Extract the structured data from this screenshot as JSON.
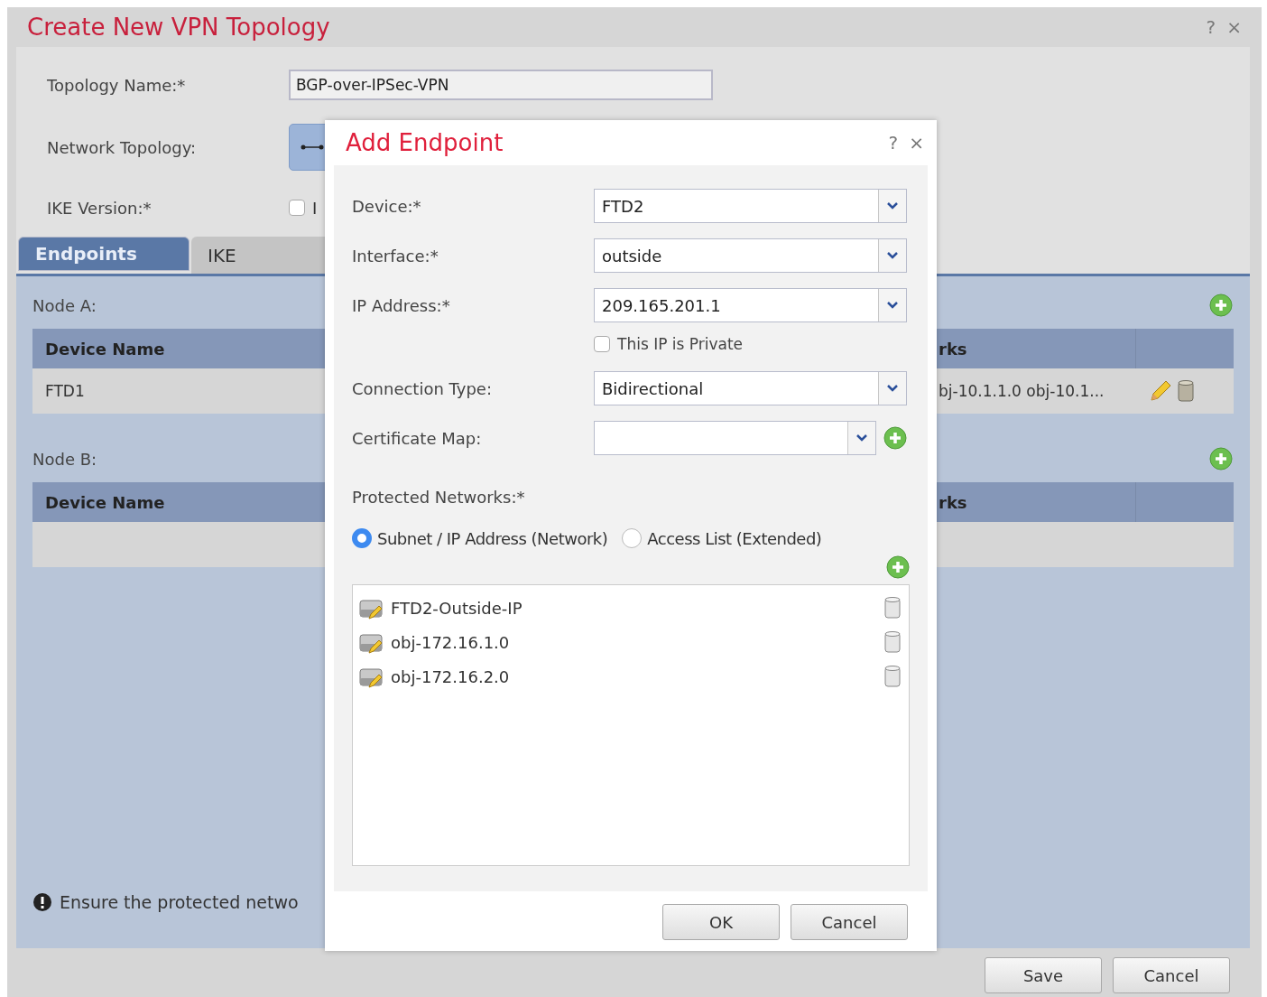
{
  "window": {
    "title": "Create New VPN Topology",
    "help": "?",
    "close": "×"
  },
  "form": {
    "topology_name": {
      "label": "Topology Name:*",
      "value": "BGP-over-IPSec-VPN"
    },
    "network_topology": {
      "label": "Network Topology:"
    },
    "ike_version": {
      "label": "IKE Version:*",
      "checked": false,
      "option": "I"
    }
  },
  "tabs": [
    {
      "label": "Endpoints",
      "selected": true
    },
    {
      "label": "IKE",
      "selected": false
    }
  ],
  "nodes": [
    {
      "label": "Node A:",
      "columns": [
        "Device Name",
        "rks"
      ],
      "rows": [
        {
          "device": "FTD1",
          "networks": "bj-10.1.1.0 obj-10.1..."
        }
      ]
    },
    {
      "label": "Node B:",
      "columns": [
        "Device Name",
        "rks"
      ]
    }
  ],
  "note": "Ensure the protected netwo",
  "footer_buttons": [
    "Save",
    "Cancel"
  ],
  "dialog": {
    "title": "Add Endpoint",
    "help": "?",
    "close": "×",
    "fields": [
      {
        "kind": "select",
        "label": "Device:*",
        "value": "FTD2"
      },
      {
        "kind": "select",
        "label": "Interface:*",
        "value": "outside"
      },
      {
        "kind": "select",
        "label": "IP Address:*",
        "value": "209.165.201.1"
      },
      {
        "kind": "checkbox",
        "label": "This IP is Private",
        "checked": false
      },
      {
        "kind": "select",
        "label": "Connection Type:",
        "value": "Bidirectional"
      },
      {
        "kind": "select_add",
        "label": "Certificate Map:"
      }
    ],
    "protected_networks": {
      "label": "Protected Networks:*",
      "options": [
        {
          "label": "Subnet / IP Address (Network)",
          "selected": true
        },
        {
          "label": "Access List (Extended)",
          "selected": false
        }
      ],
      "items": [
        "FTD2-Outside-IP",
        "obj-172.16.1.0",
        "obj-172.16.2.0"
      ]
    },
    "buttons": [
      "OK",
      "Cancel"
    ]
  }
}
